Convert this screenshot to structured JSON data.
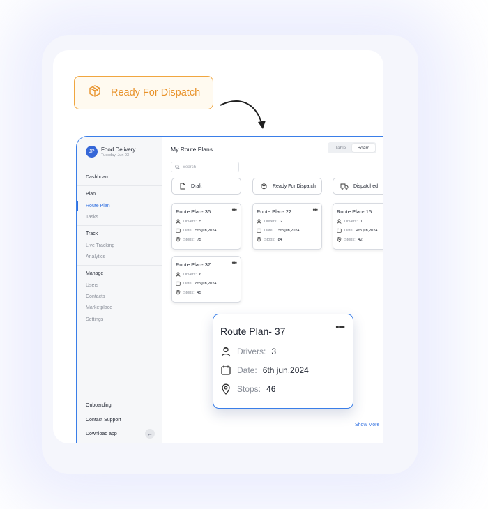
{
  "callout": {
    "label": "Ready For Dispatch",
    "icon": "package-icon",
    "color": "#e8922a"
  },
  "profile": {
    "initials": "JP",
    "name": "Food Delivery",
    "date": "Tuesday, Jun 03"
  },
  "sidebar": {
    "dashboard": "Dashboard",
    "plan_header": "Plan",
    "route_plan": "Route Plan",
    "tasks": "Tasks",
    "track_header": "Track",
    "live_tracking": "Live Tracking",
    "analytics": "Analytics",
    "manage_header": "Manage",
    "users": "Users",
    "contacts": "Contacts",
    "marketplace": "Marketplace",
    "settings": "Settings",
    "onboarding": "Onboarding",
    "contact_support": "Contact Support",
    "download_app": "Download app"
  },
  "main": {
    "title": "My Route Plans",
    "view_toggle": {
      "table": "Table",
      "board": "Board",
      "selected": "Board"
    },
    "search_placeholder": "Search",
    "columns": [
      {
        "label": "Draft",
        "icon": "document-icon"
      },
      {
        "label": "Ready For Dispatch",
        "icon": "package-icon"
      },
      {
        "label": "Dispatched",
        "icon": "truck-icon"
      }
    ],
    "field_labels": {
      "drivers": "Drivers:",
      "date": "Date:",
      "stops": "Stops:"
    },
    "cards": [
      {
        "title": "Route Plan- 36",
        "drivers": "5",
        "date": "5th jun,2024",
        "stops": "75"
      },
      {
        "title": "Route Plan- 22",
        "drivers": "2",
        "date": "15th jun,2024",
        "stops": "84"
      },
      {
        "title": "Route Plan- 15",
        "drivers": "1",
        "date": "4th jun,2024",
        "stops": "42"
      },
      {
        "title": "Route Plan- 37",
        "drivers": "6",
        "date": "8th jun,2024",
        "stops": "45"
      }
    ],
    "show_more": "Show More"
  },
  "highlight_card": {
    "title": "Route Plan- 37",
    "drivers": "3",
    "date": "6th jun,2024",
    "stops": "46"
  },
  "colors": {
    "accent": "#2f6fe0",
    "callout_border": "#f0a640"
  }
}
